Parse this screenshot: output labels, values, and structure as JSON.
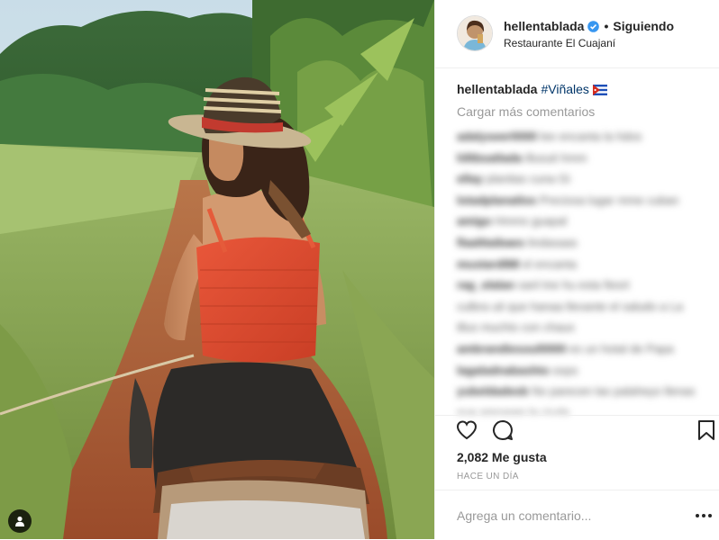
{
  "post": {
    "username": "hellentablada",
    "follow_status": "Siguiendo",
    "location": "Restaurante El Cuajaní",
    "caption_user": "hellentablada",
    "caption_hashtag": "#Viñales",
    "load_more_label": "Cargar más comentarios",
    "likes_text": "2,082 Me gusta",
    "timestamp": "HACE UN DÍA",
    "add_comment_placeholder": "Agrega un comentario..."
  },
  "icons": {
    "verified": "verified-badge-icon",
    "flag": "cuba-flag-icon",
    "like": "heart-icon",
    "comment": "comment-bubble-icon",
    "save": "bookmark-icon",
    "more": "more-options-icon",
    "tagged_users": "user-tag-icon"
  },
  "colors": {
    "verified_blue": "#3897f0",
    "hashtag": "#003569",
    "muted_text": "#999999",
    "divider": "#efefef"
  },
  "comments": [
    {
      "user": "adalyseer0000",
      "text": "lee encanta la hdos"
    },
    {
      "user": "hlltbsatlada",
      "text": "illusuti hmm"
    },
    {
      "user": "ellay",
      "text": "planitas cuna Gi"
    },
    {
      "user": "lotadplanatlos",
      "text": "Preciosa lugar mme cuban"
    },
    {
      "user": "amigo",
      "text": "Hmms guapal"
    },
    {
      "user": "flaalttaibaes",
      "text": "lindasaas"
    },
    {
      "user": "mustardl88",
      "text": "el encanta"
    },
    {
      "user": "rag_elalan",
      "text": "sanl tne hu esta fiesrt"
    },
    {
      "user": "",
      "text": "culbra uti que hanaa llevante el saludo a La"
    },
    {
      "user": "",
      "text": "tllus muchis con chaus"
    },
    {
      "user": "ambrandiesoul0000",
      "text": "es un hotal de Papa"
    },
    {
      "user": "lagaladnabashto",
      "text": "oops"
    },
    {
      "user": "yubeldadesb",
      "text": "No parecen las palaheyo llenas"
    },
    {
      "user": "",
      "text": "que amparen la ciuda"
    }
  ]
}
